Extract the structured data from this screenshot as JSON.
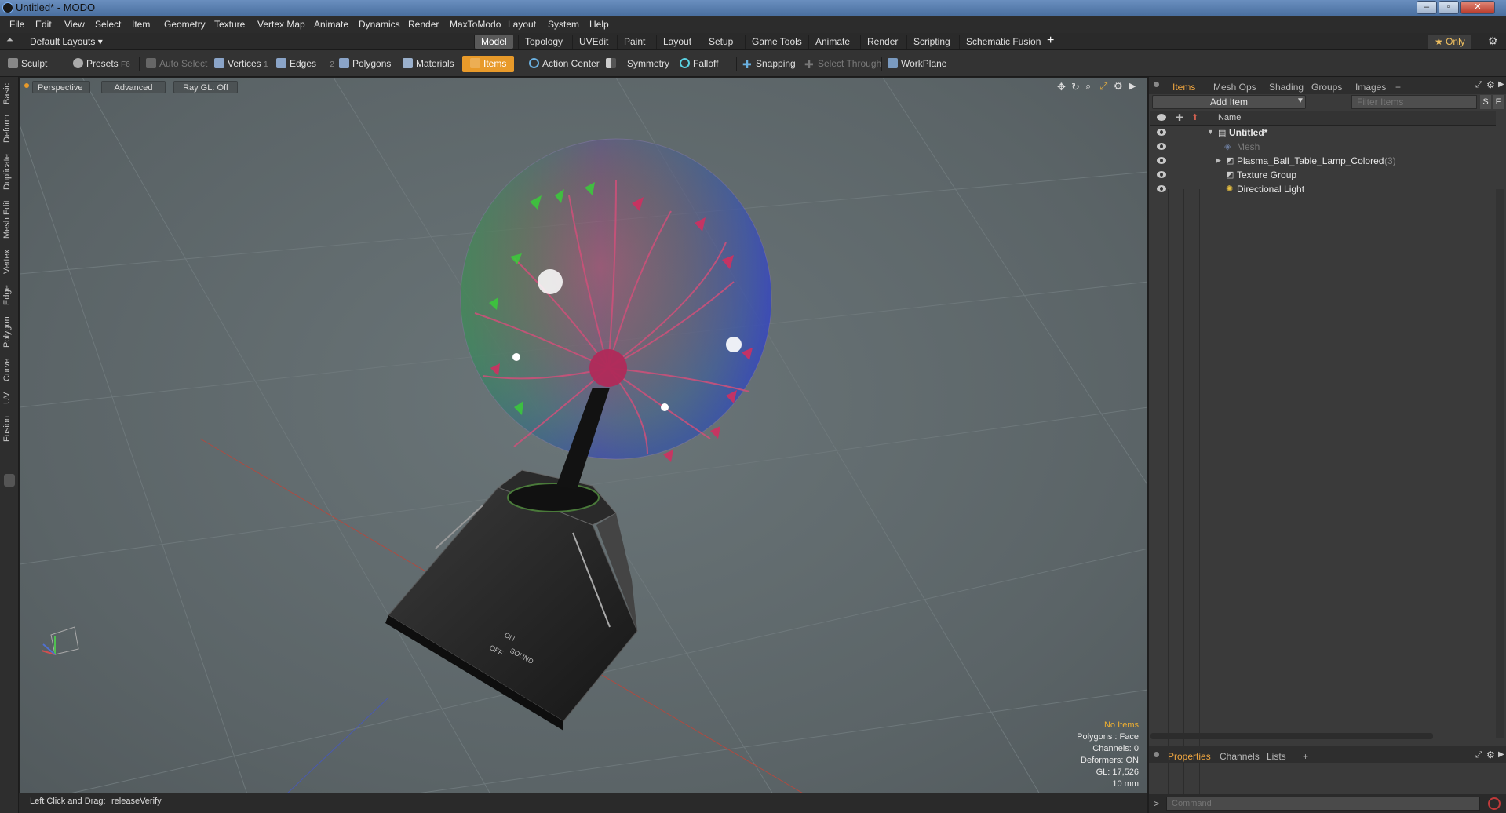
{
  "window": {
    "title": "Untitled* - MODO",
    "minimize": "–",
    "maximize": "▫",
    "close": "✕"
  },
  "menu": [
    "File",
    "Edit",
    "View",
    "Select",
    "Item",
    "Geometry",
    "Texture",
    "Vertex Map",
    "Animate",
    "Dynamics",
    "Render",
    "MaxToModo",
    "Layout",
    "System",
    "Help"
  ],
  "layouts": {
    "selector": "Default Layouts ▾",
    "tabs": [
      "Model",
      "Topology",
      "UVEdit",
      "Paint",
      "Layout",
      "Setup",
      "Game Tools",
      "Animate",
      "Render",
      "Scripting",
      "Schematic Fusion"
    ],
    "active": "Model",
    "add": "+",
    "only": "★ Only"
  },
  "toolbar": {
    "sculpt": "Sculpt",
    "presets": "Presets",
    "presets_key": "F6",
    "auto_select": "Auto Select",
    "vertices": "Vertices",
    "vertices_key": "1",
    "edges": "Edges",
    "edges_key": "2",
    "polygons": "Polygons",
    "materials": "Materials",
    "items": "Items",
    "action_center": "Action Center",
    "symmetry": "Symmetry",
    "falloff": "Falloff",
    "snapping": "Snapping",
    "select_through": "Select Through",
    "workplane": "WorkPlane"
  },
  "left_tabs": [
    "Basic",
    "Deform",
    "Duplicate",
    "Mesh Edit",
    "Vertex",
    "Edge",
    "Polygon",
    "Curve",
    "UV",
    "Fusion"
  ],
  "viewport": {
    "view": "Perspective",
    "shading": "Advanced",
    "raygl": "Ray GL: Off",
    "info": {
      "selection": "No Items",
      "polygons": "Polygons : Face",
      "channels": "Channels: 0",
      "deformers": "Deformers: ON",
      "gl": "GL: 17,526",
      "units": "10 mm"
    },
    "switch_on": "ON",
    "switch_off": "OFF",
    "switch_sound": "SOUND"
  },
  "status": {
    "hint": "Left Click and Drag:",
    "action": "releaseVerify"
  },
  "items_panel": {
    "tabs": [
      "Items",
      "Mesh Ops",
      "Shading",
      "Groups",
      "Images"
    ],
    "active": "Items",
    "add_item": "Add Item",
    "filter_placeholder": "Filter Items",
    "s_btn": "S",
    "f_btn": "F",
    "name_header": "Name",
    "tree": [
      {
        "name": "Untitled*",
        "depth": 0,
        "bold": true
      },
      {
        "name": "Mesh",
        "depth": 1,
        "dim": true
      },
      {
        "name": "Plasma_Ball_Table_Lamp_Colored",
        "depth": 1,
        "count": "(3)"
      },
      {
        "name": "Texture Group",
        "depth": 1
      },
      {
        "name": "Directional Light",
        "depth": 1
      }
    ]
  },
  "properties_panel": {
    "tabs": [
      "Properties",
      "Channels",
      "Lists"
    ],
    "active": "Properties",
    "add": "+"
  },
  "command": {
    "placeholder": "Command",
    "prompt": ">"
  },
  "colors": {
    "accent": "#e89a2a",
    "tab_active": "#f0a640",
    "viewport": "#5f686b"
  }
}
